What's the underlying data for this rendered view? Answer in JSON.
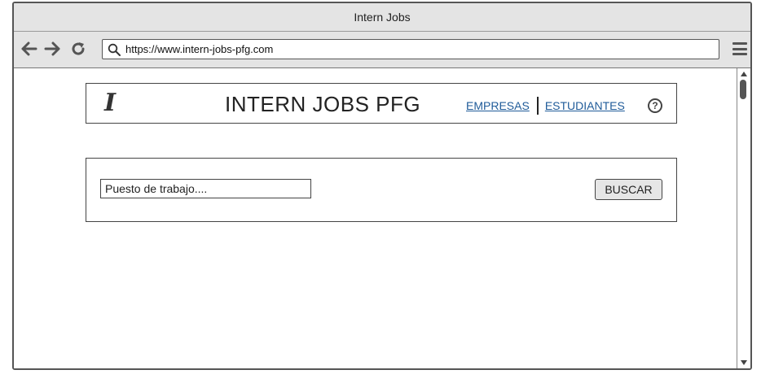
{
  "window": {
    "title": "Intern Jobs"
  },
  "toolbar": {
    "back_icon": "arrow-left-icon",
    "forward_icon": "arrow-right-icon",
    "reload_icon": "reload-icon",
    "search_icon": "search-icon",
    "url": "https://www.intern-jobs-pfg.com",
    "menu_icon": "hamburger-menu-icon"
  },
  "header": {
    "logo": "I",
    "title": "INTERN JOBS PFG",
    "links": [
      "EMPRESAS",
      "ESTUDIANTES"
    ],
    "help_icon": "help-icon",
    "help_glyph": "?"
  },
  "search": {
    "placeholder": "Puesto de trabajo....",
    "button_label": "BUSCAR"
  },
  "colors": {
    "link": "#1f5b99",
    "chrome": "#e4e4e4",
    "border": "#444444"
  }
}
